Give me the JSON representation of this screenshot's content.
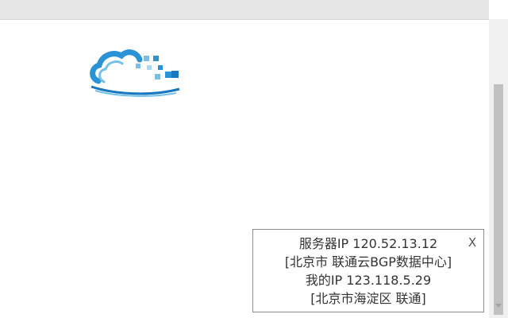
{
  "logo": {
    "icon": "cloud-data-logo-icon",
    "colors": {
      "primary": "#2a93d5",
      "light": "#74c0ea",
      "dark": "#1877c0"
    }
  },
  "popup": {
    "server_line": "服务器IP 120.52.13.12",
    "server_location": "[北京市 联通云BGP数据中心]",
    "my_line": "我的IP 123.118.5.29",
    "my_location": "[北京市海淀区 联通]",
    "close_label": "X"
  },
  "scrollbar": {
    "thumb_color": "#c1c1c1",
    "track_color": "#f0f0f0"
  }
}
